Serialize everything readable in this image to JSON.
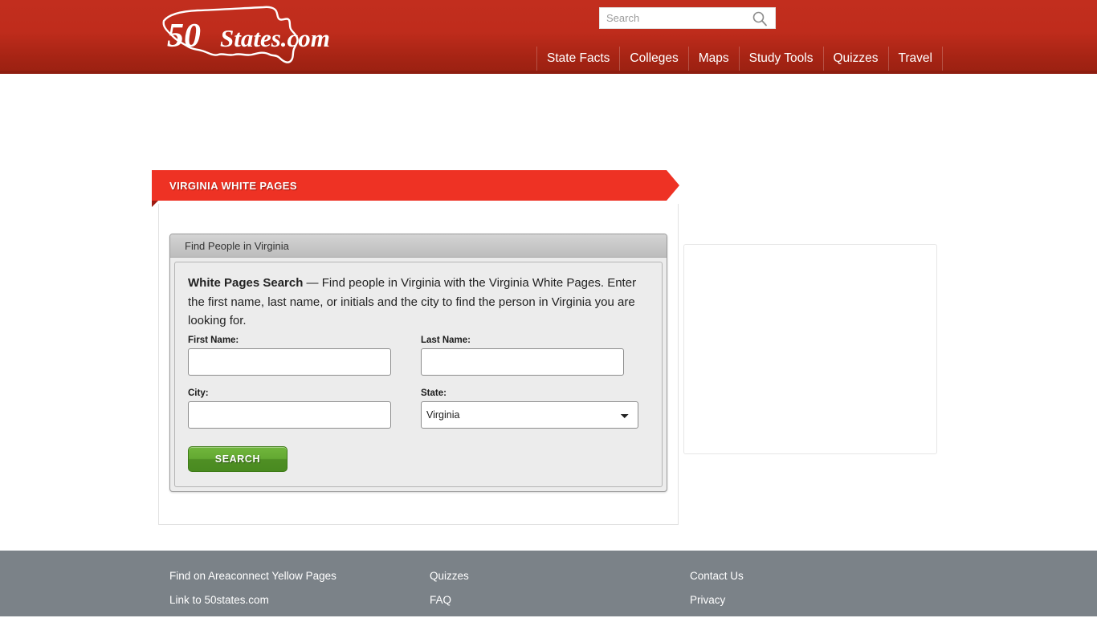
{
  "header": {
    "logo": {
      "number": "50",
      "word": "States",
      "tld": ".com",
      "alt": "50states.com logo with United States map outline"
    },
    "search": {
      "placeholder": "Search",
      "value": "",
      "icon": "search-icon"
    },
    "nav": [
      {
        "label": "State Facts"
      },
      {
        "label": "Colleges"
      },
      {
        "label": "Maps"
      },
      {
        "label": "Study Tools"
      },
      {
        "label": "Quizzes"
      },
      {
        "label": "Travel"
      }
    ],
    "colors": {
      "bar_top": "#c22e1e",
      "bar_bottom": "#9c2112",
      "bar_border": "#8e1d10"
    }
  },
  "main": {
    "ribbon_title": "VIRGINIA WHITE PAGES",
    "ribbon_color": "#ee3224",
    "form_box_header": "Find People in Virginia",
    "intro": {
      "lead": "White Pages Search",
      "rest": " — Find people in Virginia with the Virginia White Pages. Enter the first name, last name, or initials and the city to find the person in Virginia you are looking for."
    },
    "fields": {
      "first_name_label": "First Name:",
      "first_name_value": "",
      "last_name_label": "Last Name:",
      "last_name_value": "",
      "city_label": "City:",
      "city_value": "",
      "state_label": "State:",
      "state_value": "Virginia",
      "state_options": [
        "Virginia"
      ]
    },
    "search_button": "SEARCH"
  },
  "sidebar": {
    "ad_placeholder": ""
  },
  "footer": {
    "background": "#7b8288",
    "columns": [
      {
        "links": [
          {
            "label": "Find on Areaconnect Yellow Pages"
          },
          {
            "label": "Link to 50states.com"
          }
        ]
      },
      {
        "links": [
          {
            "label": "Quizzes"
          },
          {
            "label": "FAQ"
          }
        ]
      },
      {
        "links": [
          {
            "label": "Contact Us"
          },
          {
            "label": "Privacy"
          }
        ]
      }
    ]
  }
}
